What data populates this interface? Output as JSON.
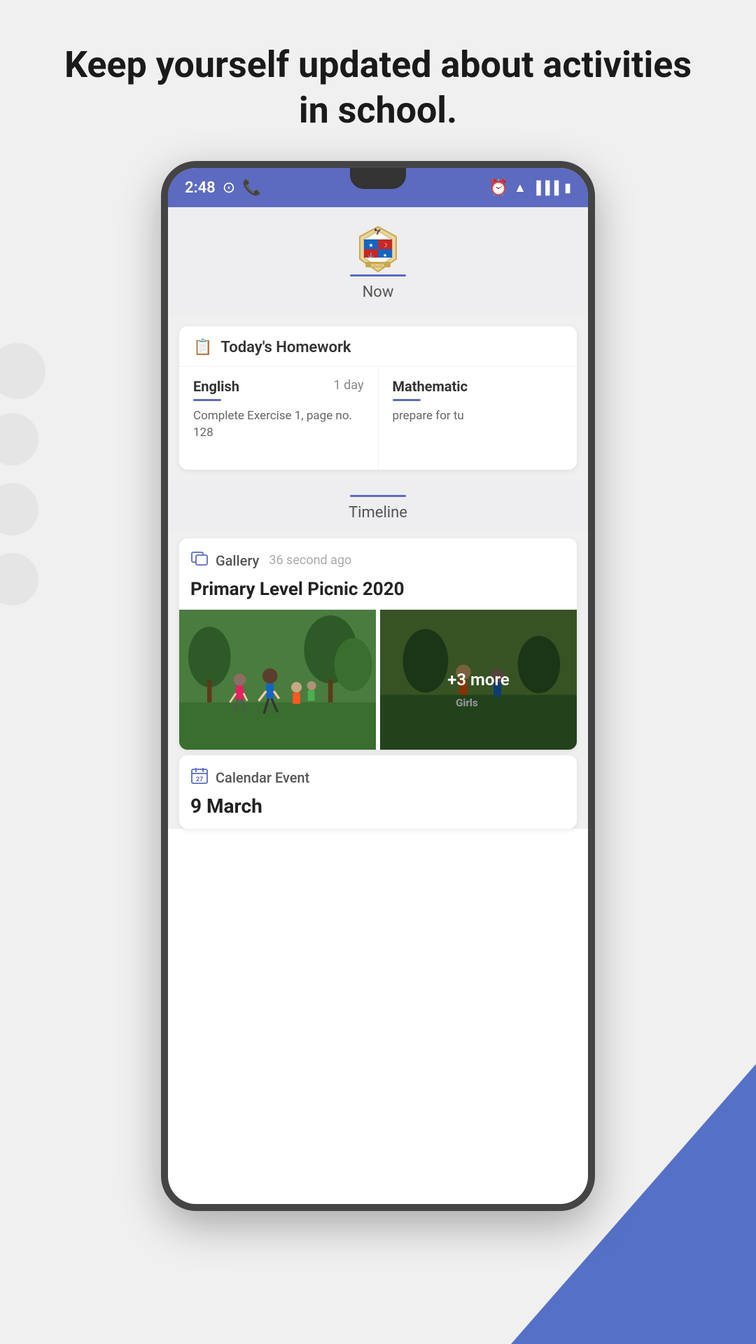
{
  "page": {
    "header": "Keep yourself updated about activities in school.",
    "background_circles": 4
  },
  "status_bar": {
    "time": "2:48",
    "color": "#5c6bc0"
  },
  "app": {
    "logo_alt": "School Crest",
    "now_divider": true,
    "now_label": "Now",
    "homework_section": {
      "icon": "📋",
      "title": "Today's Homework",
      "items": [
        {
          "subject": "English",
          "days": "1 day",
          "description": "Complete Exercise 1, page no. 128"
        },
        {
          "subject": "Mathematic",
          "days": "",
          "description": "prepare for tu"
        }
      ]
    },
    "timeline_label": "Timeline",
    "gallery_post": {
      "icon": "🖼",
      "type": "Gallery",
      "time": "36 second ago",
      "title": "Primary Level Picnic 2020",
      "more_count": "+3 more"
    },
    "calendar_event": {
      "icon": "📅",
      "type": "Calendar Event",
      "date": "9 March"
    }
  }
}
